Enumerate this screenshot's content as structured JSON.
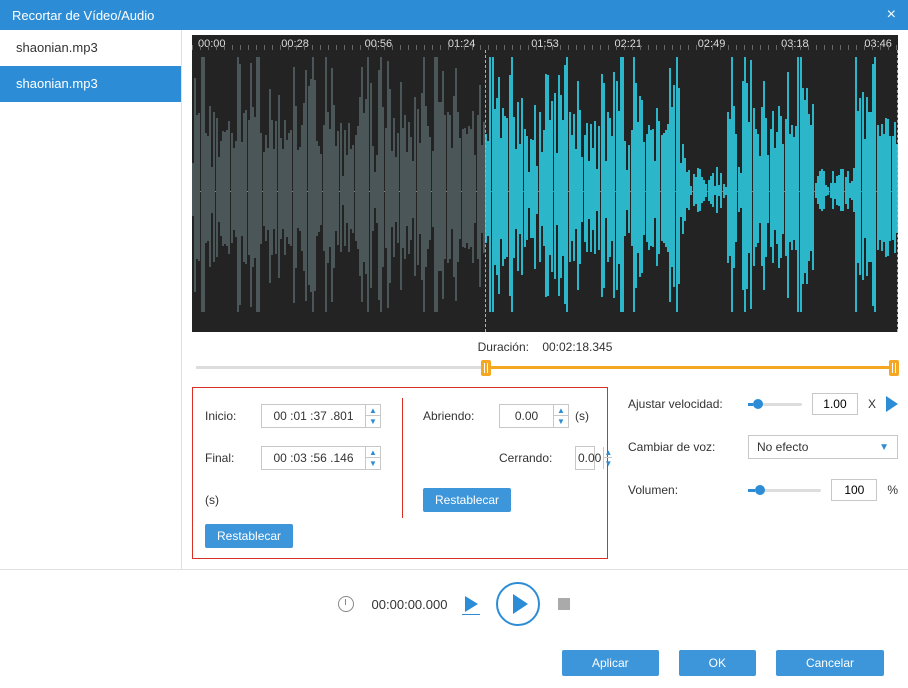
{
  "window": {
    "title": "Recortar de Vídeo/Audio"
  },
  "sidebar": {
    "items": [
      {
        "label": "shaonian.mp3"
      },
      {
        "label": "shaonian.mp3"
      }
    ],
    "selected_index": 1
  },
  "timeruler": [
    "00:00",
    "00:28",
    "00:56",
    "01:24",
    "01:53",
    "02:21",
    "02:49",
    "03:18",
    "03:46"
  ],
  "selection": {
    "start_pct": 41.5,
    "end_pct": 100
  },
  "duration": {
    "label": "Duración:",
    "value": "00:02:18.345"
  },
  "trim": {
    "inicio_label": "Inicio:",
    "inicio_value": "00 :01 :37 .801",
    "final_label": "Final:",
    "final_value": "00 :03 :56 .146",
    "abriendo_label": "Abriendo:",
    "abriendo_value": "0.00",
    "cerrando_label": "Cerrando:",
    "cerrando_value": "0.00",
    "seconds_suffix": "(s)",
    "reset_label": "Restablecar"
  },
  "speed": {
    "label": "Ajustar velocidad:",
    "value": "1.00",
    "suffix": "X"
  },
  "voice": {
    "label": "Cambiar de voz:",
    "value": "No efecto"
  },
  "volume": {
    "label": "Volumen:",
    "value": "100",
    "suffix": "%"
  },
  "playback": {
    "time": "00:00:00.000"
  },
  "buttons": {
    "apply": "Aplicar",
    "ok": "OK",
    "cancel": "Cancelar"
  }
}
